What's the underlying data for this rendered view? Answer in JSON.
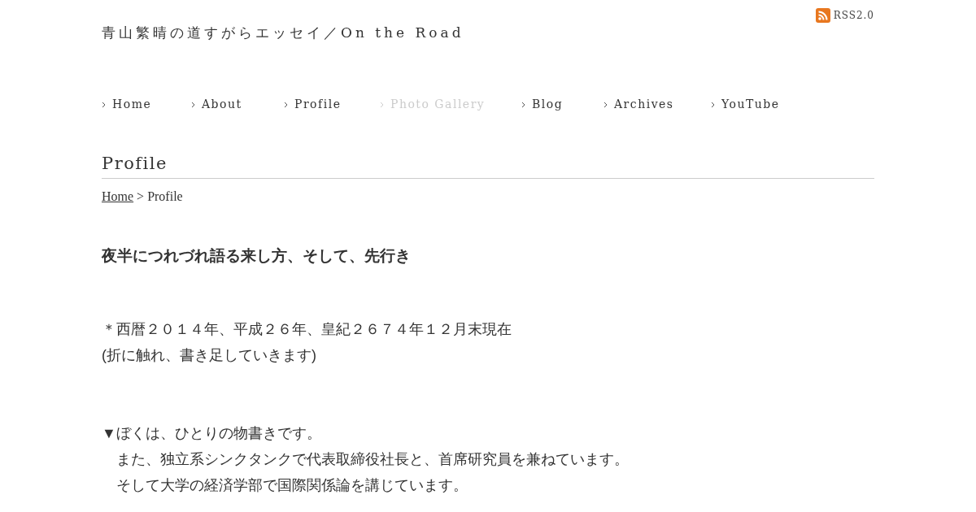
{
  "site_title": "青山繁晴の道すがらエッセイ／On the Road",
  "rss": {
    "label": "RSS2.0"
  },
  "nav": [
    {
      "label": "Home",
      "dimmed": false
    },
    {
      "label": "About",
      "dimmed": false
    },
    {
      "label": "Profile",
      "dimmed": false
    },
    {
      "label": "Photo Gallery",
      "dimmed": true
    },
    {
      "label": "Blog",
      "dimmed": false
    },
    {
      "label": "Archives",
      "dimmed": false
    },
    {
      "label": "YouTube",
      "dimmed": false
    }
  ],
  "page_title": "Profile",
  "breadcrumb": {
    "link": "Home",
    "separator": ">",
    "current": "Profile"
  },
  "heading": "夜半につれづれ語る来し方、そして、先行き",
  "paragraphs": [
    [
      "＊西暦２０１４年、平成２６年、皇紀２６７４年１２月末現在",
      "(折に触れ、書き足していきます)"
    ],
    [
      "▼ぼくは、ひとりの物書きです。",
      "　また、独立系シンクタンクで代表取締役社長と、首席研究員を兼ねています。",
      "　そして大学の経済学部で国際関係論を講じています。"
    ]
  ]
}
